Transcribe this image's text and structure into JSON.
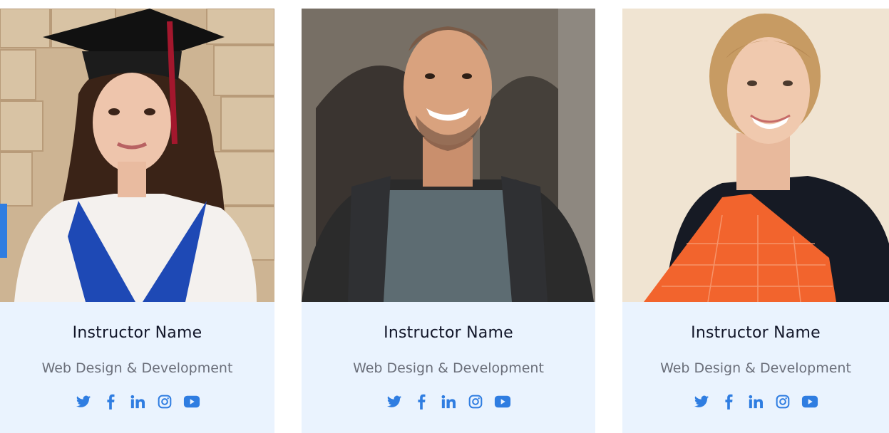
{
  "colors": {
    "card_bg": "#eaf3fe",
    "name": "#111528",
    "role": "#6b6f7a",
    "social": "#2f7de1",
    "accent_tab": "#2f7de1"
  },
  "instructors": [
    {
      "name": "Instructor Name",
      "role": "Web Design & Development",
      "photo_icon": "graduate-portrait-photo",
      "social": [
        "twitter-icon",
        "facebook-icon",
        "linkedin-icon",
        "instagram-icon",
        "youtube-icon"
      ]
    },
    {
      "name": "Instructor Name",
      "role": "Web Design & Development",
      "photo_icon": "smiling-man-backpack-photo",
      "social": [
        "twitter-icon",
        "facebook-icon",
        "linkedin-icon",
        "instagram-icon",
        "youtube-icon"
      ]
    },
    {
      "name": "Instructor Name",
      "role": "Web Design & Development",
      "photo_icon": "smiling-woman-folder-photo",
      "social": [
        "twitter-icon",
        "facebook-icon",
        "linkedin-icon",
        "instagram-icon",
        "youtube-icon"
      ]
    }
  ]
}
